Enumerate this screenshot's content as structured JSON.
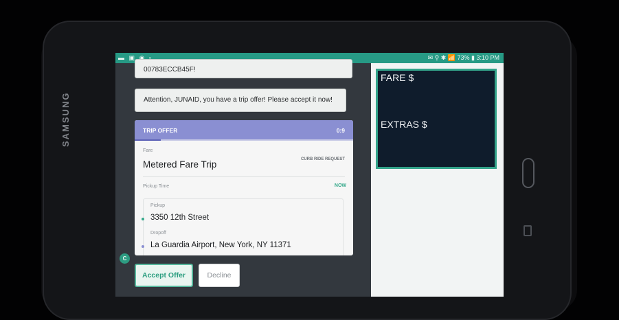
{
  "device": {
    "brand": "SAMSUNG"
  },
  "statusbar": {
    "left_icons": "▬ ▣ ◉ ▫",
    "right_text": "✉ ⚲ ✱ 📶 73% ▮ 3:10 PM",
    "battery": "73%",
    "time": "3:10 PM"
  },
  "messages": {
    "top_code": "00783ECCB45F!",
    "attention": "Attention, JUNAID, you have a trip offer! Please accept it now!"
  },
  "trip_offer": {
    "header_title": "TRIP OFFER",
    "timer": "0:9",
    "progress_fraction": 0.12,
    "fare_label": "Fare",
    "fare_value": "Metered Fare Trip",
    "request_badge": "CURB RIDE REQUEST",
    "pickup_time_label": "Pickup Time",
    "pickup_time_value": "NOW",
    "pickup_label": "Pickup",
    "pickup_address": "3350 12th Street",
    "dropoff_label": "Dropoff",
    "dropoff_address": "La Guardia Airport, New York, NY 11371"
  },
  "avatar_letter": "C",
  "actions": {
    "accept_label": "Accept Offer",
    "decline_label": "Decline"
  },
  "meter": {
    "fare_label": "FARE $",
    "extras_label": "EXTRAS $"
  },
  "colors": {
    "accent": "#279a85",
    "offer_header": "#8a8fd2",
    "meter_bg": "#0f1c2c",
    "pickup_dot": "#36a98b",
    "dropoff_dot": "#8a8fd2"
  }
}
